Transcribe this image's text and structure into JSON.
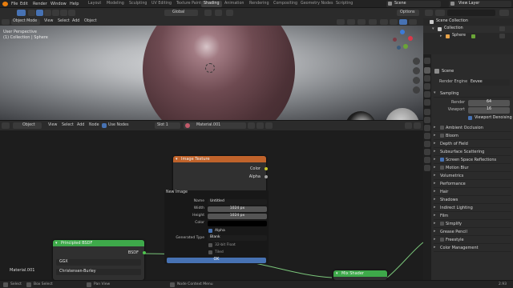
{
  "menubar": {
    "items": [
      "File",
      "Edit",
      "Render",
      "Window",
      "Help"
    ],
    "workspaces": [
      "Layout",
      "Modeling",
      "Sculpting",
      "UV Editing",
      "Texture Paint",
      "Shading",
      "Animation",
      "Rendering",
      "Compositing",
      "Geometry Nodes",
      "Scripting"
    ],
    "active_workspace": "Shading",
    "scene_label": "Scene",
    "view_layer_label": "View Layer"
  },
  "viewport": {
    "mode": "Object Mode",
    "menu": [
      "View",
      "Select",
      "Add",
      "Object"
    ],
    "orientation": "Global",
    "options_label": "Options",
    "overlay_line1": "User Perspective",
    "overlay_line2": "(1) Collection | Sphere"
  },
  "node_editor": {
    "editor_type": "Object",
    "menu": [
      "View",
      "Select",
      "Add",
      "Node"
    ],
    "use_nodes_label": "Use Nodes",
    "slot_label": "Slot 1",
    "material_name": "Material.001",
    "material_corner_label": "Material.001",
    "nodes": {
      "image_texture": {
        "title": "Image Texture",
        "outputs": [
          "Color",
          "Alpha"
        ]
      },
      "principled": {
        "title": "Principled BSDF",
        "output": "BSDF",
        "distribution": "GGX",
        "subsurface": "Christensen-Burley"
      },
      "mix_shader": {
        "title": "Mix Shader"
      }
    }
  },
  "new_image_popup": {
    "title": "New Image",
    "name_label": "Name",
    "name_value": "Untitled",
    "width_label": "Width",
    "width_value": "1024 px",
    "height_label": "Height",
    "height_value": "1024 px",
    "color_label": "Color",
    "alpha_label": "Alpha",
    "alpha_checked": true,
    "generated_type_label": "Generated Type",
    "generated_type_value": "Blank",
    "float_label": "32-bit Float",
    "tiled_label": "Tiled",
    "ok_label": "OK"
  },
  "outliner": {
    "items": [
      {
        "label": "Scene Collection",
        "indent": 0
      },
      {
        "label": "Collection",
        "indent": 1
      },
      {
        "label": "Sphere",
        "indent": 2
      }
    ]
  },
  "properties": {
    "scene_label": "Scene",
    "render_engine_label": "Render Engine",
    "render_engine_value": "Eevee",
    "sampling_label": "Sampling",
    "render_label": "Render",
    "render_value": "64",
    "viewport_label": "Viewport",
    "viewport_value": "16",
    "viewport_denoising_label": "Viewport Denoising",
    "sections": [
      {
        "label": "Ambient Occlusion",
        "check": true,
        "checked": false
      },
      {
        "label": "Bloom",
        "check": true,
        "checked": false
      },
      {
        "label": "Depth of Field",
        "check": false
      },
      {
        "label": "Subsurface Scattering",
        "check": false
      },
      {
        "label": "Screen Space Reflections",
        "check": true,
        "checked": true
      },
      {
        "label": "Motion Blur",
        "check": true,
        "checked": false
      },
      {
        "label": "Volumetrics",
        "check": false
      },
      {
        "label": "Performance",
        "check": false
      },
      {
        "label": "Hair",
        "check": false
      },
      {
        "label": "Shadows",
        "check": false
      },
      {
        "label": "Indirect Lighting",
        "check": false
      },
      {
        "label": "Film",
        "check": false
      },
      {
        "label": "Simplify",
        "check": true,
        "checked": false
      },
      {
        "label": "Grease Pencil",
        "check": false
      },
      {
        "label": "Freestyle",
        "check": true,
        "checked": false
      },
      {
        "label": "Color Management",
        "check": false
      }
    ]
  },
  "statusbar": {
    "select_label": "Select",
    "box_select_label": "Box Select",
    "pan_view_label": "Pan View",
    "context_menu_label": "Node Context Menu",
    "version": "2.93"
  },
  "colors": {
    "accent": "#4772b3",
    "node_texture": "#c0632b",
    "node_shader": "#3ea94a"
  }
}
